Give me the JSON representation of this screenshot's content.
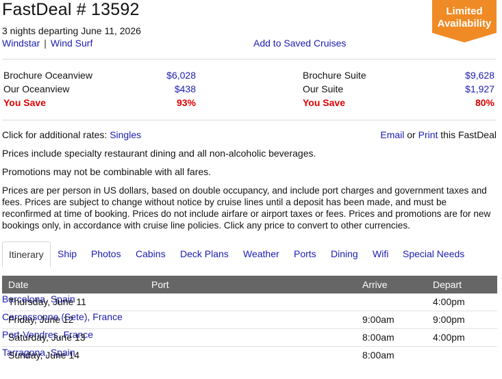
{
  "deal": {
    "title": "FastDeal # 13592",
    "subtitle": "3 nights departing June 11, 2026",
    "cruise_line": "Windstar",
    "ship": "Wind Surf",
    "save_link": "Add to Saved Cruises",
    "badge_line1": "Limited",
    "badge_line2": "Availability"
  },
  "colors": {
    "badge": "#f08a24",
    "save": "#e00000",
    "link": "#1b1bb0",
    "table_header": "#666666"
  },
  "rates": {
    "left": [
      {
        "label": "Brochure Oceanview",
        "value": "$6,028"
      },
      {
        "label": "Our Oceanview",
        "value": "$438"
      },
      {
        "label": "You Save",
        "value": "93%"
      }
    ],
    "right": [
      {
        "label": "Brochure Suite",
        "value": "$9,628"
      },
      {
        "label": "Our Suite",
        "value": "$1,927"
      },
      {
        "label": "You Save",
        "value": "80%"
      }
    ]
  },
  "extra": {
    "additional_rates_prefix": "Click for additional rates: ",
    "singles": "Singles",
    "email": "Email",
    "or": " or ",
    "print": "Print",
    "this_fastdeal": " this FastDeal"
  },
  "notes": {
    "dining": "Prices include specialty restaurant dining and all non-alcoholic beverages.",
    "promotions": "Promotions may not be combinable with all fares.",
    "disclaimer": "Prices are per person in US dollars, based on double occupancy, and include port charges and government taxes and fees. Prices are subject to change without notice by cruise lines until a deposit has been made, and must be reconfirmed at time of booking. Prices do not include airfare or airport taxes or fees. Prices and promotions are for new bookings only, in accordance with cruise line policies. Click any price to convert to other currencies."
  },
  "tabs": [
    "Itinerary",
    "Ship",
    "Photos",
    "Cabins",
    "Deck Plans",
    "Weather",
    "Ports",
    "Dining",
    "Wifi",
    "Special Needs"
  ],
  "itinerary": {
    "headers": {
      "date": "Date",
      "port": "Port",
      "arrive": "Arrive",
      "depart": "Depart"
    },
    "rows": [
      {
        "date": "Thursday, June 11",
        "port": "Barcelona, Spain",
        "arrive": "",
        "depart": "4:00pm"
      },
      {
        "date": "Friday, June 12",
        "port": "Carcassonne (Sete), France",
        "arrive": "9:00am",
        "depart": "9:00pm"
      },
      {
        "date": "Saturday, June 13",
        "port": "Port-Vendres, France",
        "arrive": "8:00am",
        "depart": "4:00pm"
      },
      {
        "date": "Sunday, June 14",
        "port": "Tarragona, Spain",
        "arrive": "8:00am",
        "depart": ""
      }
    ]
  }
}
